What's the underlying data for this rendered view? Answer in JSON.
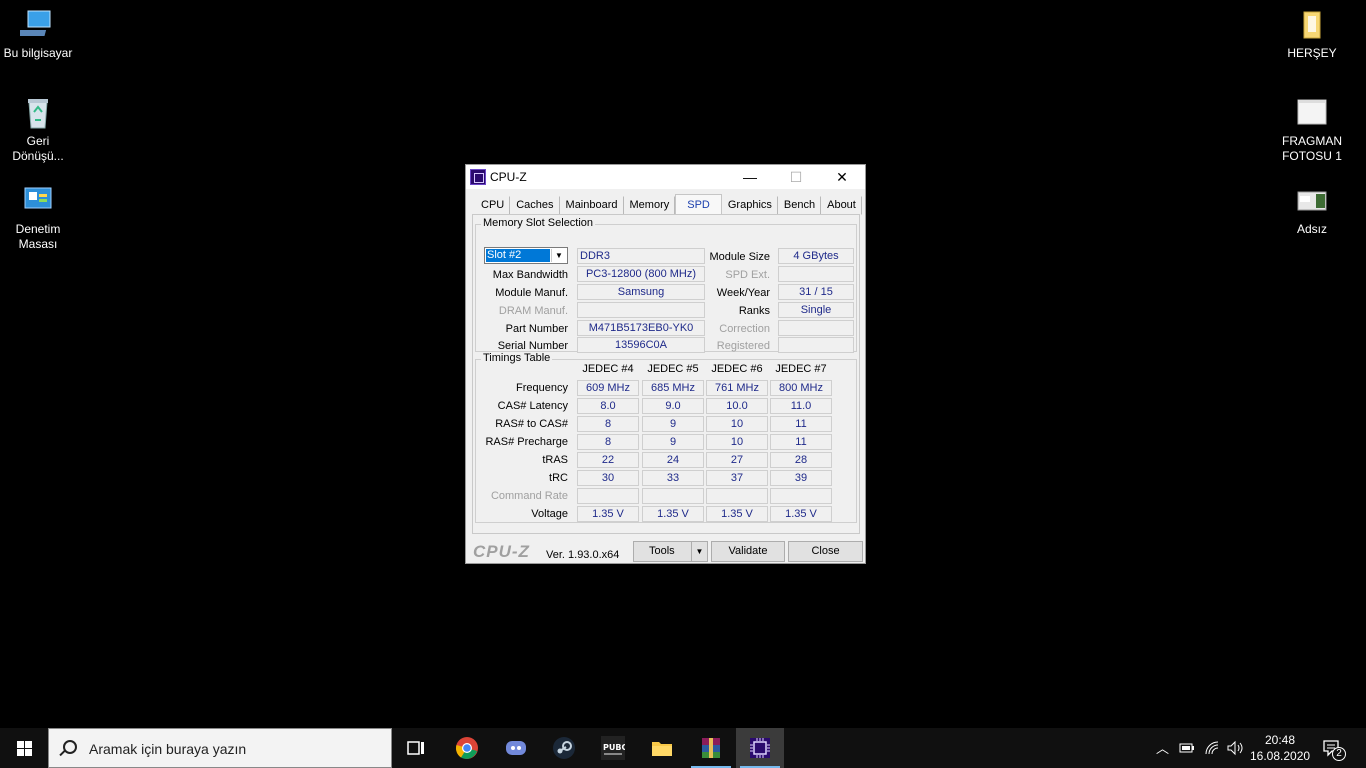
{
  "desktop": {
    "icons_left": [
      {
        "label": "Bu bilgisayar"
      },
      {
        "label": "Geri\nDönüşü..."
      },
      {
        "label": "Denetim\nMasası"
      }
    ],
    "icons_right": [
      {
        "label": "HERŞEY"
      },
      {
        "label": "FRAGMAN\nFOTOSU 1"
      },
      {
        "label": "Adsız"
      }
    ]
  },
  "window": {
    "title": "CPU-Z",
    "controls": {
      "minimize": "—",
      "maximize": "☐",
      "close": "✕"
    },
    "tabs": [
      "CPU",
      "Caches",
      "Mainboard",
      "Memory",
      "SPD",
      "Graphics",
      "Bench",
      "About"
    ],
    "active_tab": "SPD",
    "slot_group": {
      "title": "Memory Slot Selection",
      "slot_selected": "Slot #2",
      "type": "DDR3",
      "labels": {
        "max_bandwidth": "Max Bandwidth",
        "module_manuf": "Module Manuf.",
        "dram_manuf": "DRAM Manuf.",
        "part_number": "Part Number",
        "serial_number": "Serial Number",
        "module_size": "Module Size",
        "spd_ext": "SPD Ext.",
        "week_year": "Week/Year",
        "ranks": "Ranks",
        "correction": "Correction",
        "registered": "Registered"
      },
      "values": {
        "max_bandwidth": "PC3-12800 (800 MHz)",
        "module_manuf": "Samsung",
        "dram_manuf": "",
        "part_number": "M471B5173EB0-YK0",
        "serial_number": "13596C0A",
        "module_size": "4 GBytes",
        "spd_ext": "",
        "week_year": "31 / 15",
        "ranks": "Single",
        "correction": "",
        "registered": ""
      }
    },
    "timings": {
      "title": "Timings Table",
      "columns": [
        "JEDEC #4",
        "JEDEC #5",
        "JEDEC #6",
        "JEDEC #7"
      ],
      "rows": [
        {
          "label": "Frequency",
          "values": [
            "609 MHz",
            "685 MHz",
            "761 MHz",
            "800 MHz"
          ]
        },
        {
          "label": "CAS# Latency",
          "values": [
            "8.0",
            "9.0",
            "10.0",
            "11.0"
          ]
        },
        {
          "label": "RAS# to CAS#",
          "values": [
            "8",
            "9",
            "10",
            "11"
          ]
        },
        {
          "label": "RAS# Precharge",
          "values": [
            "8",
            "9",
            "10",
            "11"
          ]
        },
        {
          "label": "tRAS",
          "values": [
            "22",
            "24",
            "27",
            "28"
          ]
        },
        {
          "label": "tRC",
          "values": [
            "30",
            "33",
            "37",
            "39"
          ]
        },
        {
          "label": "Command Rate",
          "values": [
            "",
            "",
            "",
            ""
          ]
        },
        {
          "label": "Voltage",
          "values": [
            "1.35 V",
            "1.35 V",
            "1.35 V",
            "1.35 V"
          ]
        }
      ]
    },
    "footer": {
      "brand": "CPU-Z",
      "version": "Ver. 1.93.0.x64",
      "tools": "Tools",
      "validate": "Validate",
      "close": "Close"
    }
  },
  "taskbar": {
    "search_placeholder": "Aramak için buraya yazın",
    "time": "20:48",
    "date": "16.08.2020",
    "notification_count": "2"
  }
}
